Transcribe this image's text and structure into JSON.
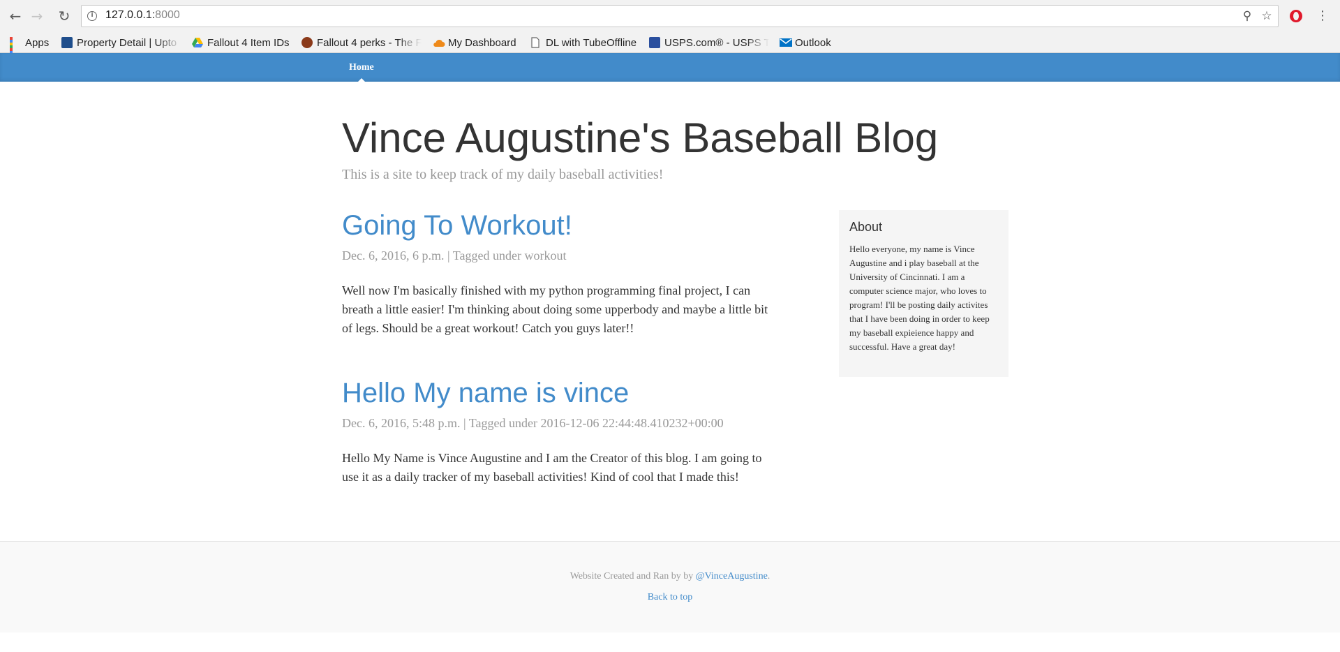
{
  "browser": {
    "url_host": "127.0.0.1:",
    "url_port": "8000",
    "bookmarks": [
      {
        "label": "Apps",
        "icon": "apps-grid-icon"
      },
      {
        "label": "Property Detail | Upto",
        "icon": "building-icon"
      },
      {
        "label": "Fallout 4 Item IDs",
        "icon": "google-drive-icon"
      },
      {
        "label": "Fallout 4 perks - The F",
        "icon": "gear-badge-icon"
      },
      {
        "label": "My Dashboard",
        "icon": "cloud-icon"
      },
      {
        "label": "DL with TubeOffline",
        "icon": "page-icon"
      },
      {
        "label": "USPS.com® - USPS Tr",
        "icon": "usps-icon"
      },
      {
        "label": "Outlook",
        "icon": "mail-icon"
      }
    ]
  },
  "site": {
    "nav_home": "Home",
    "title": "Vince Augustine's Baseball Blog",
    "description": "This is a site to keep track of my daily baseball activities!"
  },
  "posts": [
    {
      "title": "Going To Workout!",
      "meta": "Dec. 6, 2016, 6 p.m. | Tagged under workout",
      "body": "Well now I'm basically finished with my python programming final project, I can breath a little easier! I'm thinking about doing some upperbody and maybe a little bit of legs. Should be a great workout! Catch you guys later!!"
    },
    {
      "title": "Hello My name is vince",
      "meta": "Dec. 6, 2016, 5:48 p.m. | Tagged under 2016-12-06 22:44:48.410232+00:00",
      "body": "Hello My Name is Vince Augustine and I am the Creator of this blog. I am going to use it as a daily tracker of my baseball activities! Kind of cool that I made this!"
    }
  ],
  "sidebar": {
    "heading": "About",
    "text": "Hello everyone, my name is Vince Augustine and i play baseball at the University of Cincinnati. I am a computer science major, who loves to program! I'll be posting daily activites that I have been doing in order to keep my baseball expieience happy and successful. Have a great day!"
  },
  "footer": {
    "credit_prefix": "Website Created and Ran by by ",
    "credit_link": "@VinceAugustine",
    "credit_suffix": ".",
    "back_to_top": "Back to top"
  },
  "colors": {
    "accent": "#428bca",
    "muted": "#999999",
    "sidebar_bg": "#f5f5f5"
  }
}
